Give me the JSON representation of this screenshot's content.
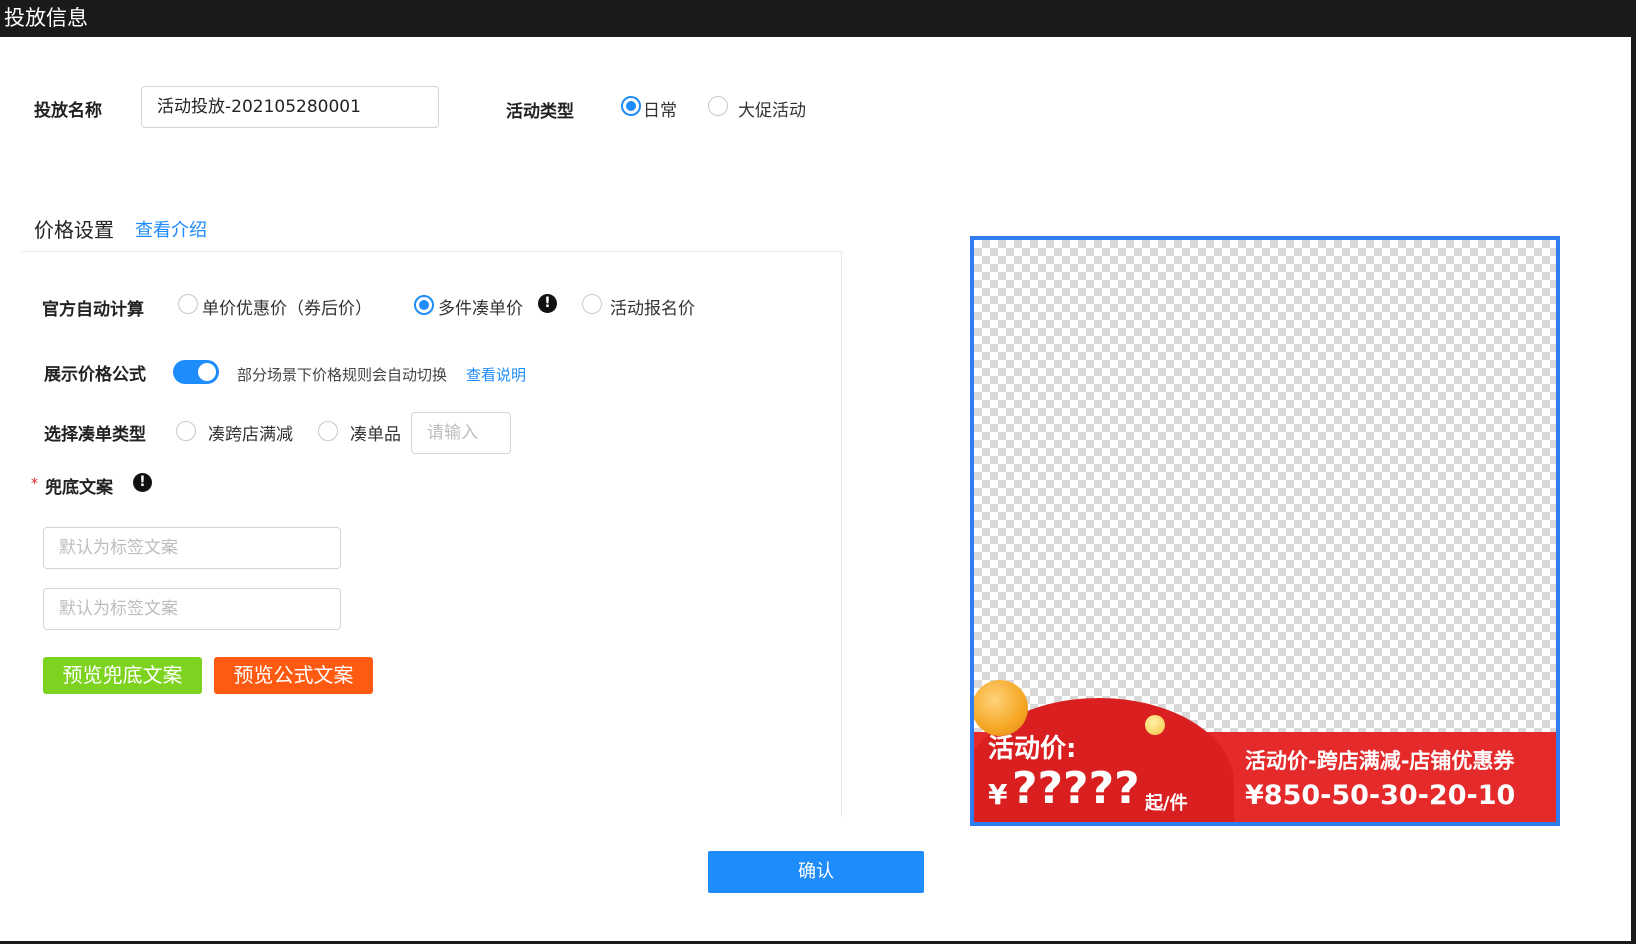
{
  "window": {
    "title": "投放信息"
  },
  "form": {
    "name_label": "投放名称",
    "name_value": "活动投放-202105280001",
    "type_label": "活动类型",
    "type_options": [
      {
        "label": "日常",
        "selected": true
      },
      {
        "label": "大促活动",
        "selected": false
      }
    ]
  },
  "price_section": {
    "title": "价格设置",
    "intro_link": "查看介绍",
    "auto_calc_label": "官方自动计算",
    "auto_calc_options": [
      {
        "label": "单价优惠价（券后价）",
        "selected": false
      },
      {
        "label": "多件凑单价",
        "selected": true
      },
      {
        "label": "活动报名价",
        "selected": false
      }
    ],
    "formula_label": "展示价格公式",
    "formula_toggle_on": true,
    "formula_hint": "部分场景下价格规则会自动切换",
    "formula_link": "查看说明",
    "bundle_type_label": "选择凑单类型",
    "bundle_options": [
      {
        "label": "凑跨店满减",
        "selected": false
      },
      {
        "label": "凑单品",
        "selected": false
      }
    ],
    "bundle_input_placeholder": "请输入",
    "required_mark": "*",
    "fallback_label": "兜底文案",
    "fallback_placeholder_1": "默认为标签文案",
    "fallback_placeholder_2": "默认为标签文案",
    "preview_fallback_button": "预览兜底文案",
    "preview_formula_button": "预览公式文案"
  },
  "preview": {
    "price_label": "活动价:",
    "currency": "¥",
    "price_value": "?????",
    "price_unit": "起/件",
    "formula_title": "活动价-跨店满减-店铺优惠券",
    "formula_value": "¥850-50-30-20-10"
  },
  "footer": {
    "confirm_button": "确认"
  },
  "colors": {
    "accent": "#1e8cfa",
    "green_button": "#7ed321",
    "orange_button": "#ff5a12",
    "banner_red": "#e42a2a"
  }
}
